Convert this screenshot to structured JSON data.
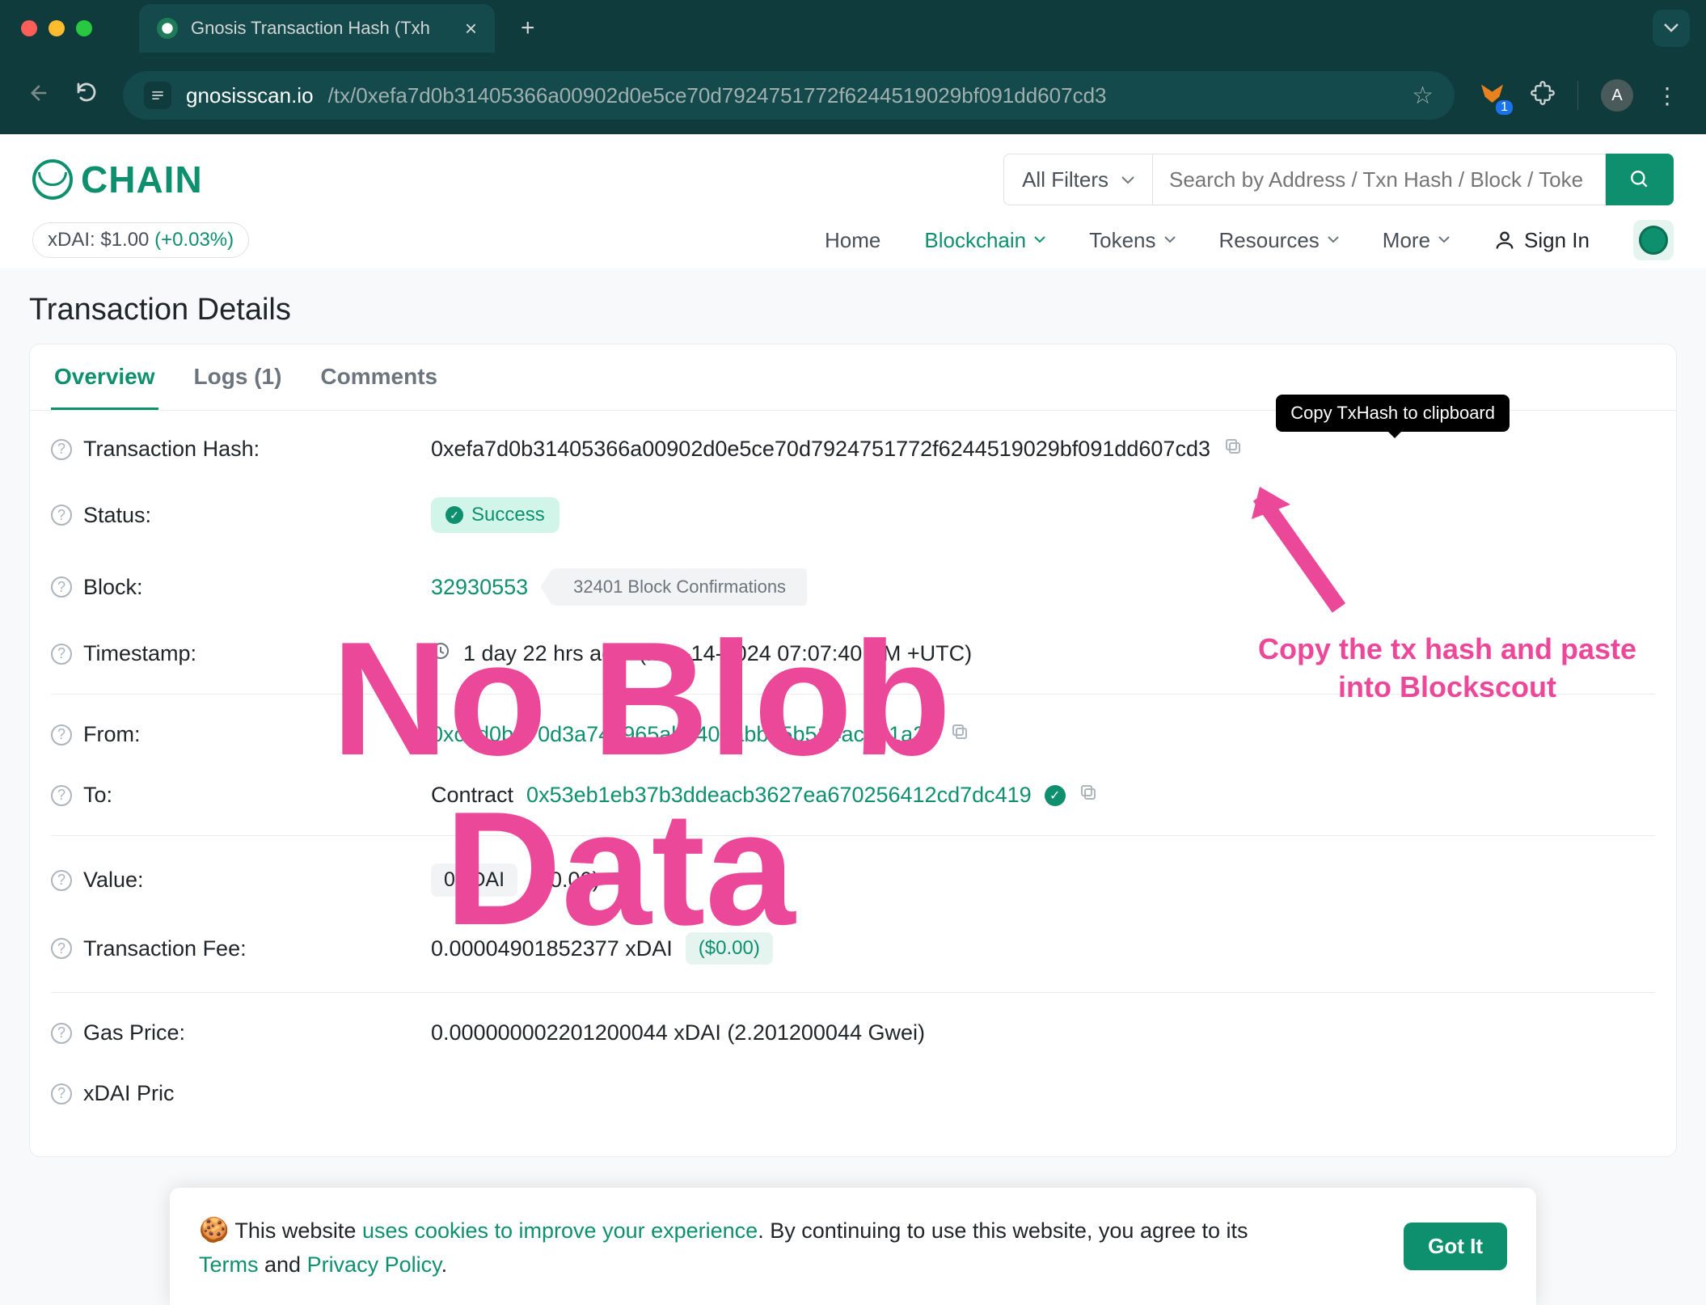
{
  "browser": {
    "tab_title": "Gnosis Transaction Hash (Txh",
    "url_domain": "gnosisscan.io",
    "url_path": "/tx/0xefa7d0b31405366a00902d0e5ce70d7924751772f6244519029bf091dd607cd3",
    "ext_badge": "1",
    "avatar_letter": "A"
  },
  "header": {
    "logo_text": "CHAIN",
    "price_label": "xDAI: $1.00",
    "price_pct": "(+0.03%)",
    "filter_label": "All Filters",
    "search_placeholder": "Search by Address / Txn Hash / Block / Toke",
    "nav": {
      "home": "Home",
      "blockchain": "Blockchain",
      "tokens": "Tokens",
      "resources": "Resources",
      "more": "More",
      "signin": "Sign In"
    }
  },
  "page": {
    "title": "Transaction Details",
    "tabs": {
      "overview": "Overview",
      "logs": "Logs (1)",
      "comments": "Comments"
    },
    "tooltip_copy": "Copy TxHash to clipboard",
    "labels": {
      "txhash": "Transaction Hash:",
      "status": "Status:",
      "block": "Block:",
      "timestamp": "Timestamp:",
      "from": "From:",
      "to": "To:",
      "value": "Value:",
      "txfee": "Transaction Fee:",
      "gasprice": "Gas Price:",
      "xdaiprice": "xDAI Pric"
    },
    "values": {
      "txhash": "0xefa7d0b31405366a00902d0e5ce70d7924751772f6244519029bf091dd607cd3",
      "status": "Success",
      "block": "32930553",
      "block_conf": "32401 Block Confirmations",
      "timestamp_rel": "1 day 22 hrs ago",
      "timestamp_abs": "(Mar-14-2024 07:07:40 PM +UTC)",
      "from": "0xc4d0b370d3a740965ab7400abb85b514ac0e1a20",
      "to_prefix": "Contract",
      "to": "0x53eb1eb37b3ddeacb3627ea670256412cd7dc419",
      "value_main": "0 xDAI",
      "value_usd": "($0.00)",
      "txfee_main": "0.00004901852377 xDAI",
      "txfee_usd": "($0.00)",
      "gasprice": "0.000000002201200044 xDAI (2.201200044 Gwei)"
    }
  },
  "annotations": {
    "overlay_line1": "No Blob",
    "overlay_line2": "Data",
    "arrow_text_line1": "Copy the tx hash and paste",
    "arrow_text_line2": "into Blockscout"
  },
  "cookie": {
    "text_pre": "This website ",
    "link1": "uses cookies to improve your experience",
    "text_mid": ". By continuing to use this website, you agree to its ",
    "terms": "Terms",
    "and": " and ",
    "privacy": "Privacy Policy",
    "dot": ".",
    "gotit": "Got It"
  }
}
